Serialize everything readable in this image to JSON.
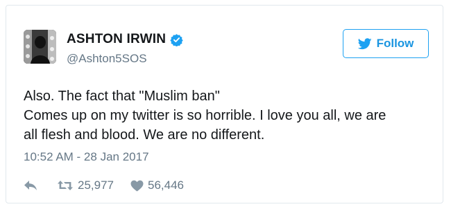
{
  "user": {
    "display_name": "ASHTON IRWIN",
    "handle": "@Ashton5SOS",
    "verified": true
  },
  "follow_button": {
    "label": "Follow"
  },
  "tweet": {
    "lines": [
      "Also. The fact that \"Muslim ban\"",
      "Comes up on my twitter is so horrible. I love you all, we are",
      "all flesh and blood. We are no different."
    ],
    "timestamp": "10:52 AM - 28 Jan 2017"
  },
  "stats": {
    "retweets": "25,977",
    "likes": "56,446"
  },
  "colors": {
    "twitter_blue": "#1da1f2",
    "secondary_text": "#657786",
    "icon_gray": "#8899a6"
  },
  "icons": {
    "verified": "verified-badge-icon",
    "follow": "twitter-bird-icon",
    "reply": "reply-icon",
    "retweet": "retweet-icon",
    "like": "heart-icon"
  }
}
